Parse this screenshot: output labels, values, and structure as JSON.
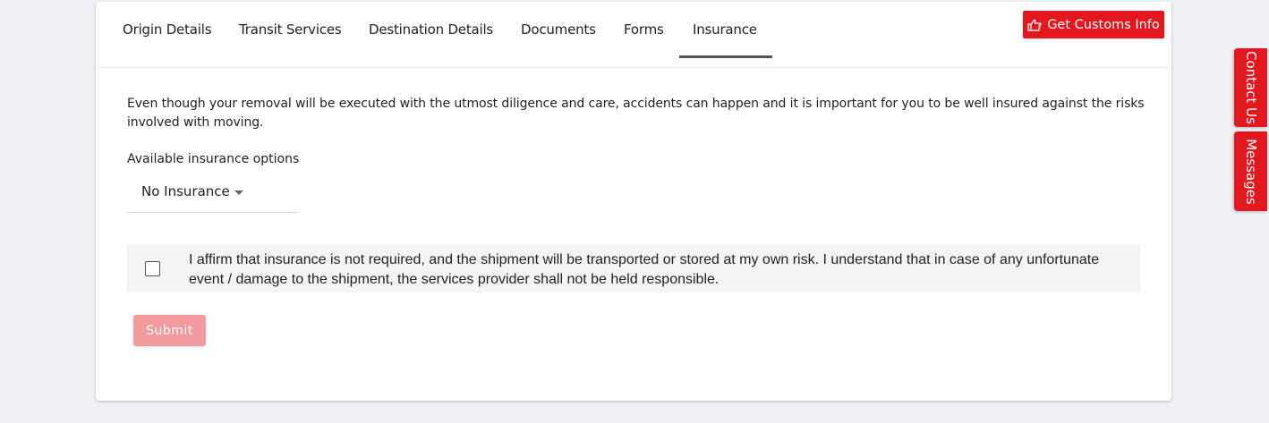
{
  "header": {
    "tabs": [
      {
        "label": "Origin Details"
      },
      {
        "label": "Transit Services"
      },
      {
        "label": "Destination Details"
      },
      {
        "label": "Documents"
      },
      {
        "label": "Forms"
      },
      {
        "label": "Insurance",
        "active": true
      }
    ],
    "customs_button": {
      "label": "Get Customs Info",
      "icon": "hand-pointing-icon"
    }
  },
  "insurance": {
    "intro": "Even though your removal will be executed with the utmost diligence and care, accidents can happen and it is important for you to be well insured against the risks involved with moving.",
    "options_label": "Available insurance options",
    "selected_option": "No Insurance",
    "affirm_text": "I affirm that insurance is not required, and the shipment will be transported or stored at my own risk. I understand that in case of any unfortunate event / damage to the shipment, the services provider shall not be held responsible.",
    "affirm_checked": false,
    "submit_label": "Submit"
  },
  "side_tabs": {
    "contact": "Contact Us",
    "messages": "Messages"
  },
  "colors": {
    "accent": "#e3171e",
    "submit_disabled": "#f29a9c",
    "page_bg": "#eef1f5"
  }
}
